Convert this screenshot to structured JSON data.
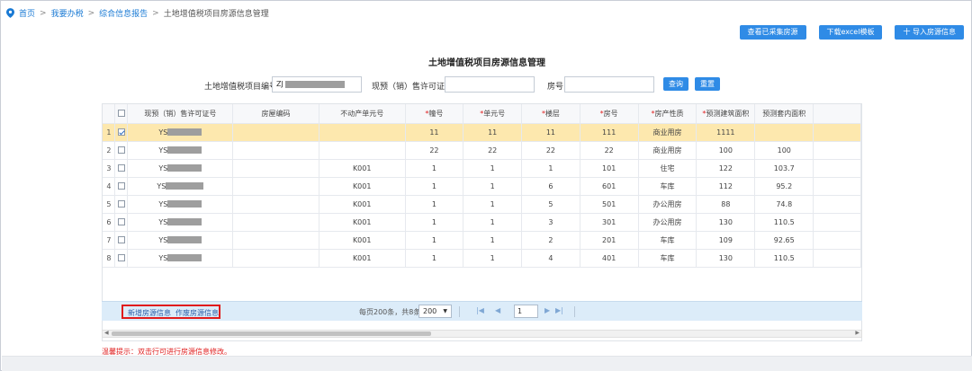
{
  "breadcrumb": {
    "items": [
      "首页",
      "我要办税",
      "综合信息报告",
      "土地增值税项目房源信息管理"
    ],
    "separator": ">"
  },
  "toolbar": {
    "view_collected": "查看已采集房源",
    "download_excel": "下载excel模板",
    "import_houses": "十 导入房源信息"
  },
  "page_title": "土地增值税项目房源信息管理",
  "search": {
    "project_no_label": "土地增值税项目编号",
    "project_no_value": "ZJ",
    "permit_label": "现预（销）售许可证号",
    "permit_value": "",
    "room_label": "房号",
    "room_value": "",
    "query_btn": "查询",
    "reset_btn": "重置"
  },
  "table": {
    "columns": [
      {
        "label": "现预（销）售许可证号",
        "required": false
      },
      {
        "label": "房屋编码",
        "required": false
      },
      {
        "label": "不动产单元号",
        "required": false
      },
      {
        "label": "幢号",
        "required": true
      },
      {
        "label": "单元号",
        "required": true
      },
      {
        "label": "楼层",
        "required": true
      },
      {
        "label": "房号",
        "required": true
      },
      {
        "label": "房产性质",
        "required": true
      },
      {
        "label": "预测建筑面积",
        "required": true
      },
      {
        "label": "预测套内面积",
        "required": false
      }
    ],
    "rows": [
      {
        "n": "1",
        "checked": true,
        "permit": "YS",
        "code": "",
        "unit_no": "",
        "building": "11",
        "unit": "11",
        "floor": "11",
        "room": "111",
        "nature": "商业用房",
        "area": "1111",
        "inner": ""
      },
      {
        "n": "2",
        "checked": false,
        "permit": "YS",
        "code": "",
        "unit_no": "",
        "building": "22",
        "unit": "22",
        "floor": "22",
        "room": "22",
        "nature": "商业用房",
        "area": "100",
        "inner": "100"
      },
      {
        "n": "3",
        "checked": false,
        "permit": "YS",
        "code": "",
        "unit_no": "K001",
        "building": "1",
        "unit": "1",
        "floor": "1",
        "room": "101",
        "nature": "住宅",
        "area": "122",
        "inner": "103.7"
      },
      {
        "n": "4",
        "checked": false,
        "permit": "YS",
        "code": "",
        "unit_no": "K001",
        "building": "1",
        "unit": "1",
        "floor": "6",
        "room": "601",
        "nature": "车库",
        "area": "112",
        "inner": "95.2"
      },
      {
        "n": "5",
        "checked": false,
        "permit": "YS",
        "code": "",
        "unit_no": "K001",
        "building": "1",
        "unit": "1",
        "floor": "5",
        "room": "501",
        "nature": "办公用房",
        "area": "88",
        "inner": "74.8"
      },
      {
        "n": "6",
        "checked": false,
        "permit": "YS",
        "code": "",
        "unit_no": "K001",
        "building": "1",
        "unit": "1",
        "floor": "3",
        "room": "301",
        "nature": "办公用房",
        "area": "130",
        "inner": "110.5"
      },
      {
        "n": "7",
        "checked": false,
        "permit": "YS",
        "code": "",
        "unit_no": "K001",
        "building": "1",
        "unit": "1",
        "floor": "2",
        "room": "201",
        "nature": "车库",
        "area": "109",
        "inner": "92.65"
      },
      {
        "n": "8",
        "checked": false,
        "permit": "YS",
        "code": "",
        "unit_no": "K001",
        "building": "1",
        "unit": "1",
        "floor": "4",
        "room": "401",
        "nature": "车库",
        "area": "130",
        "inner": "110.5"
      }
    ]
  },
  "pager": {
    "add_link": "新增房源信息",
    "void_link": "作废房源信息",
    "info": "每页200条，共8条",
    "page_size": "200",
    "page_num": "1"
  },
  "tip": "温馨提示：双击行可进行房源信息修改。",
  "colors": {
    "accent": "#2f8be6",
    "selected_row": "#fde8ae",
    "highlight_box": "#e01b1b",
    "required": "#e02020"
  }
}
